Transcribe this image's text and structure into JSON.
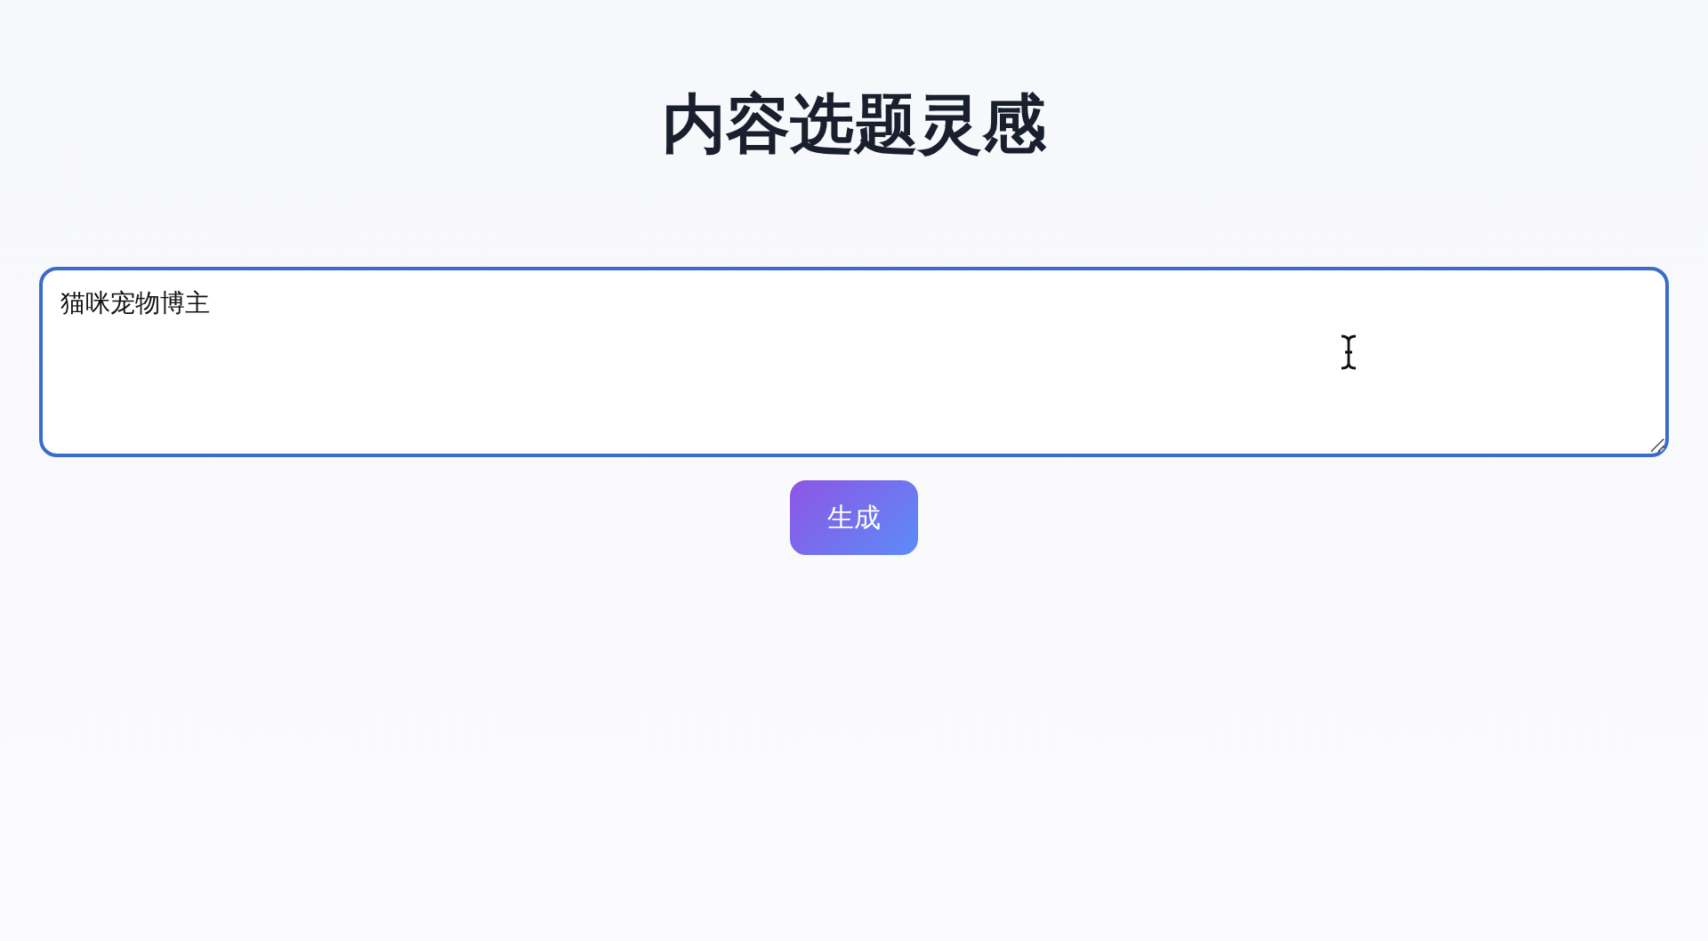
{
  "title": "内容选题灵感",
  "input": {
    "value": "猫咪宠物博主"
  },
  "buttons": [
    {
      "label": "生成"
    }
  ]
}
